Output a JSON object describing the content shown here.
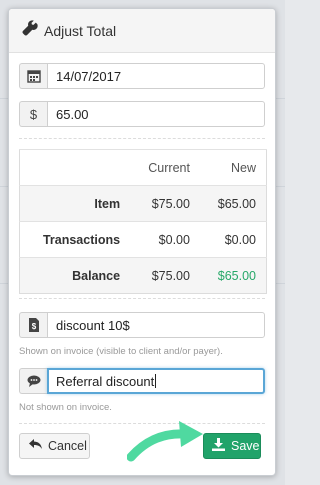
{
  "dialog": {
    "title": "Adjust Total",
    "icon": "wrench-icon",
    "date": {
      "value": "14/07/2017",
      "icon": "calendar-icon"
    },
    "amount": {
      "prefix": "$",
      "value": "65.00"
    },
    "table": {
      "headers": [
        "",
        "Current",
        "New"
      ],
      "rows": [
        {
          "label": "Item",
          "current": "$75.00",
          "new": "$65.00"
        },
        {
          "label": "Transactions",
          "current": "$0.00",
          "new": "$0.00"
        },
        {
          "label": "Balance",
          "current": "$75.00",
          "new": "$65.00"
        }
      ]
    },
    "invoice_note": {
      "icon": "invoice-icon",
      "value": "discount 10$",
      "hint": "Shown on invoice (visible to client and/or payer)."
    },
    "internal_note": {
      "icon": "comment-icon",
      "value": "Referral discount",
      "hint": "Not shown on invoice."
    },
    "buttons": {
      "cancel": "Cancel",
      "save": "Save"
    }
  },
  "colors": {
    "save": "#21a36a",
    "focus": "#5aa6d6",
    "new_balance": "#27a869",
    "arrow": "#4fd9a0"
  }
}
